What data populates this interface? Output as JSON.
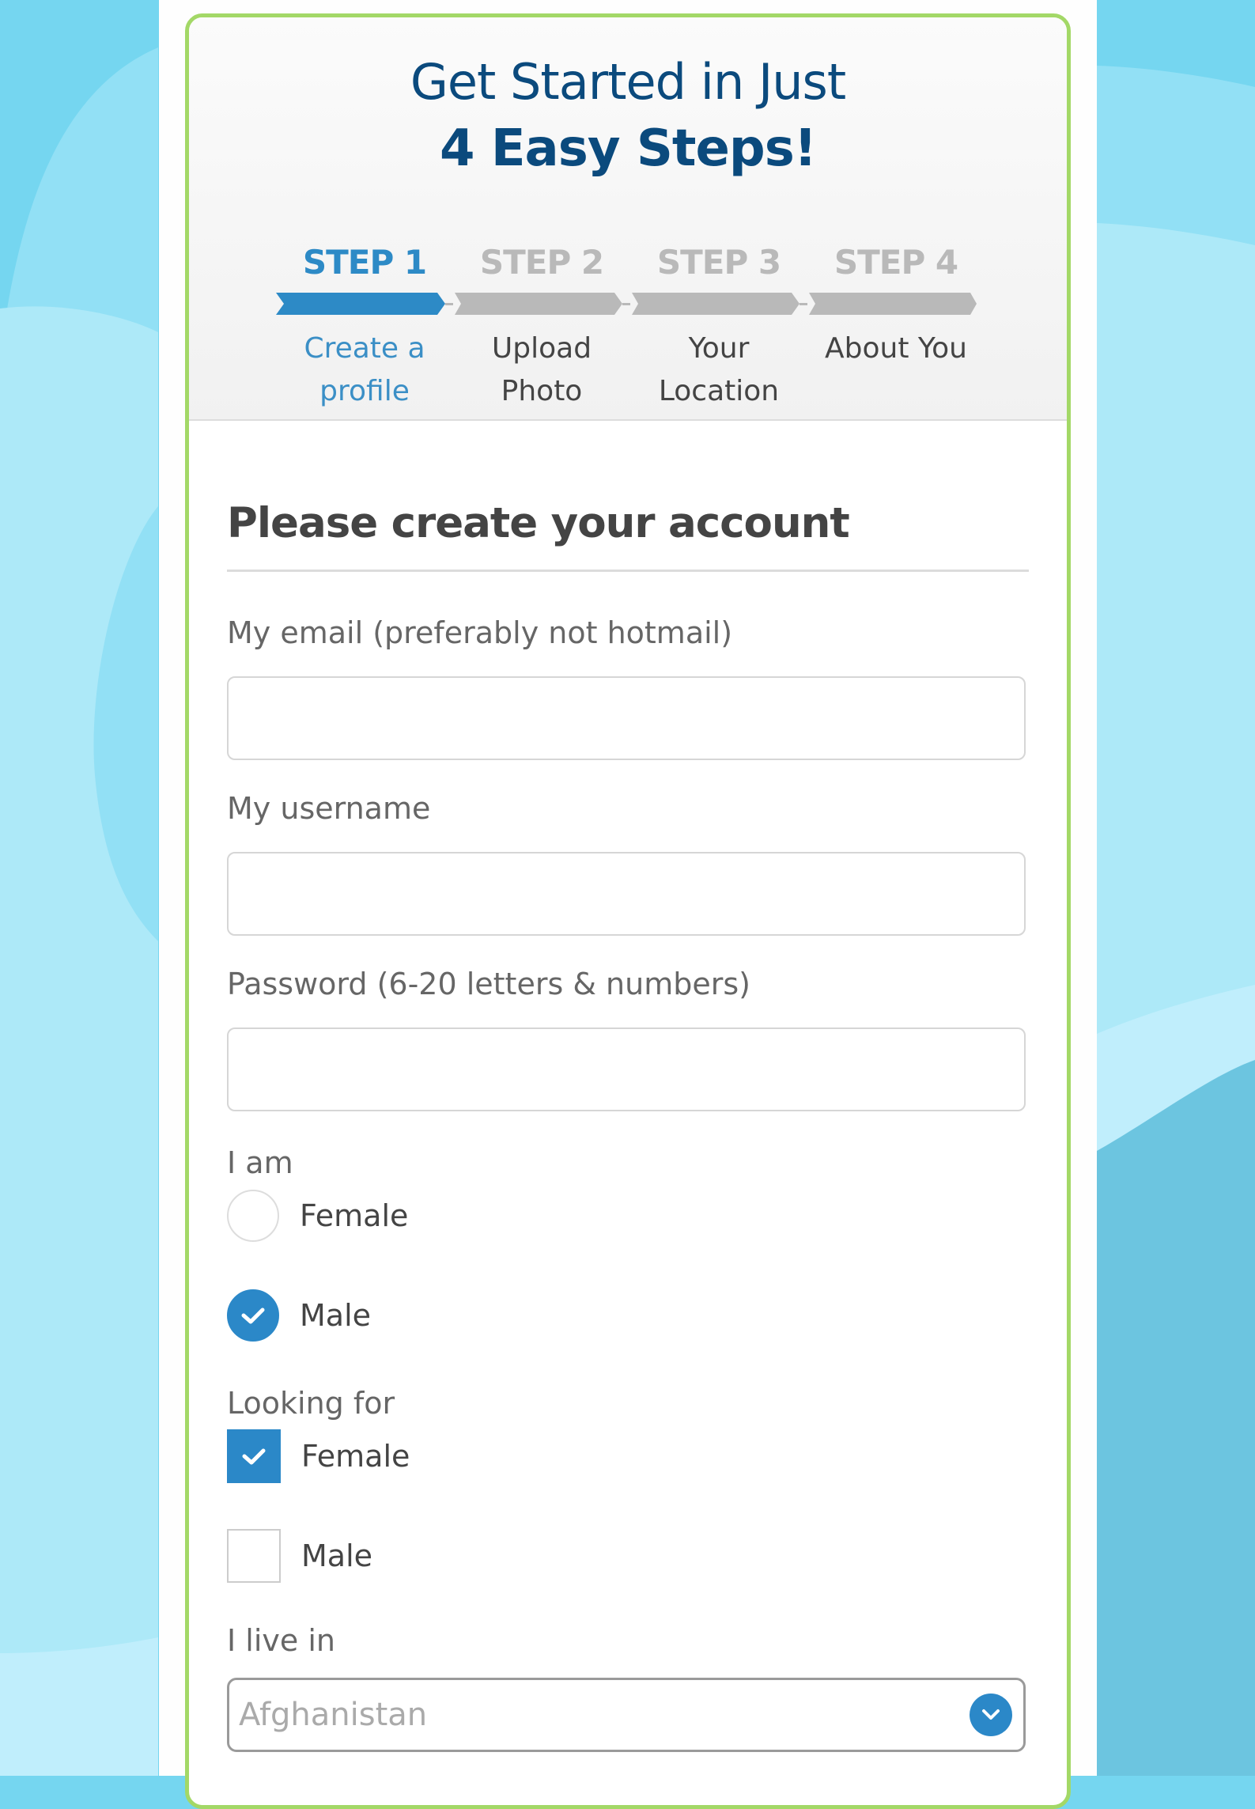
{
  "header": {
    "title_line1": "Get Started in Just",
    "title_line2": "4 Easy Steps!"
  },
  "steps": [
    {
      "number": "STEP 1",
      "label_line1": "Create a",
      "label_line2": "profile",
      "active": true
    },
    {
      "number": "STEP 2",
      "label_line1": "Upload",
      "label_line2": "Photo",
      "active": false
    },
    {
      "number": "STEP 3",
      "label_line1": "Your",
      "label_line2": "Location",
      "active": false
    },
    {
      "number": "STEP 4",
      "label_line1": "About You",
      "label_line2": "",
      "active": false
    }
  ],
  "form": {
    "title": "Please create your account",
    "email": {
      "label": "My email (preferably not hotmail)",
      "value": "",
      "placeholder": ""
    },
    "username": {
      "label": "My username",
      "value": "",
      "placeholder": ""
    },
    "password": {
      "label": "Password (6-20 letters & numbers)",
      "value": "",
      "placeholder": ""
    },
    "gender": {
      "label": "I am",
      "options": [
        {
          "label": "Female",
          "selected": false
        },
        {
          "label": "Male",
          "selected": true
        }
      ]
    },
    "looking_for": {
      "label": "Looking for",
      "options": [
        {
          "label": "Female",
          "checked": true
        },
        {
          "label": "Male",
          "checked": false
        }
      ]
    },
    "country": {
      "label": "I live in",
      "selected": "Afghanistan"
    }
  },
  "colors": {
    "accent": "#2b88c8",
    "title": "#0b4a7d",
    "card_border": "#a3d867",
    "step_inactive": "#b9b9b9",
    "background": "#75d6f0"
  }
}
